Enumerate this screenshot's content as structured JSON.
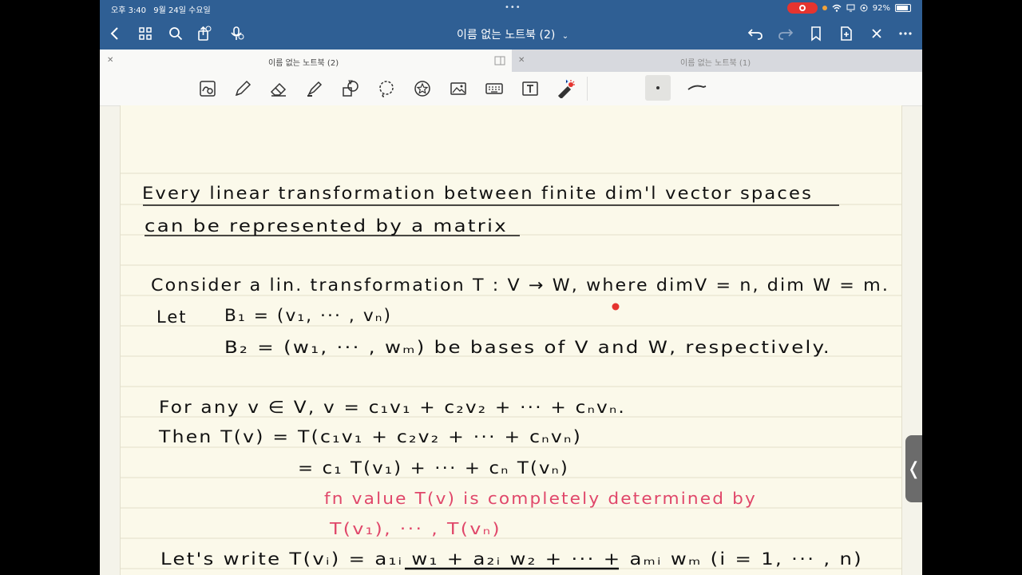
{
  "status_bar": {
    "time": "오후 3:40",
    "date": "9월 24일 수요일",
    "battery": "92%"
  },
  "app": {
    "title": "이름 없는 노트북 (2)",
    "title_chevron": "⌄"
  },
  "tabs": [
    {
      "label": "이름 없는 노트북 (2)",
      "active": true
    },
    {
      "label": "이름 없는 노트북 (1)",
      "active": false
    }
  ],
  "tools": [
    "lasso-zoom",
    "pen",
    "eraser",
    "highlighter",
    "shapes",
    "lasso",
    "sticker",
    "image",
    "keyboard",
    "text",
    "laser-pointer"
  ],
  "colors": {
    "appbar": "#2f5f94",
    "paper": "#fbf9ea",
    "ink": "#111111",
    "red_ink": "#e0476a",
    "recording": "#e5342f"
  },
  "notes": {
    "line1": "Every linear transformation between finite dim'l vector spaces",
    "line2": "can be represented by a matrix",
    "consider": "Consider a lin. transformation T : V → W, where dimV = n, dim W = m.",
    "let_label": "Let",
    "b1": "B₁ = (v₁, ··· , vₙ)",
    "b2": "B₂ = (w₁, ··· , wₘ)  be bases of V and W, respectively.",
    "for_any": "For any v ∈ V,   v = c₁v₁ + c₂v₂ + ··· + cₙvₙ.",
    "then": "Then   T(v) = T(c₁v₁ + c₂v₂ + ··· + cₙvₙ)",
    "equals": "=  c₁ T(v₁) + ··· + cₙ T(vₙ)",
    "red1": "fn value T(v) is completely determined by",
    "red2": "T(v₁), ··· , T(vₙ)",
    "lets_write": "Let's write   T(vᵢ) = a₁ᵢ w₁ + a₂ᵢ w₂ + ··· + aₘᵢ wₘ      (i = 1, ··· , n)"
  }
}
